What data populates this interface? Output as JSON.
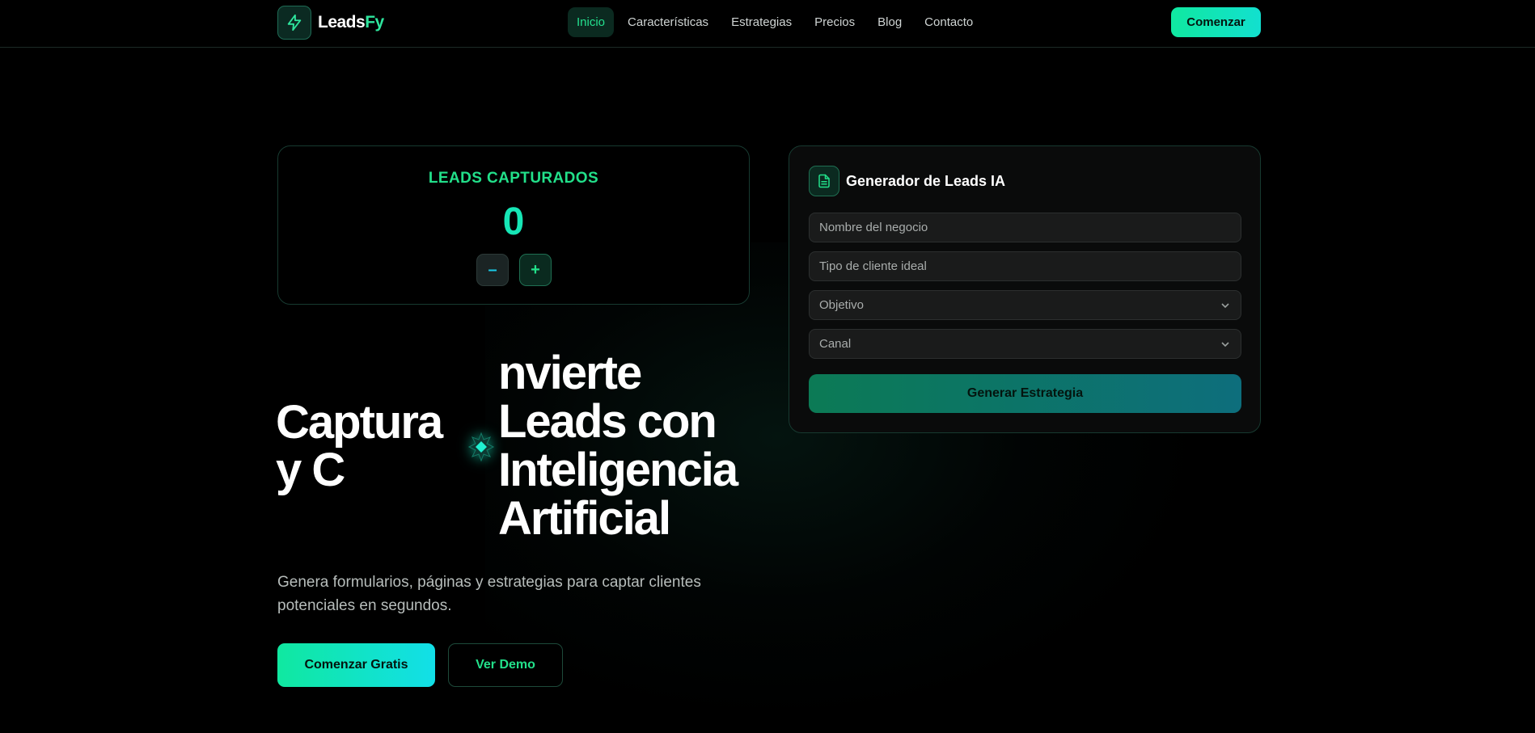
{
  "brand": {
    "name_part1": "Leads",
    "name_part2": "Fy",
    "icon": "lightning-icon"
  },
  "nav": {
    "items": [
      {
        "label": "Inicio",
        "active": true
      },
      {
        "label": "Características",
        "active": false
      },
      {
        "label": "Estrategias",
        "active": false
      },
      {
        "label": "Precios",
        "active": false
      },
      {
        "label": "Blog",
        "active": false
      },
      {
        "label": "Contacto",
        "active": false
      }
    ],
    "cta_label": "Comenzar"
  },
  "counter": {
    "title": "LEADS CAPTURADOS",
    "value": "0",
    "minus_label": "–",
    "plus_label": "+"
  },
  "hero": {
    "left_lines": [
      "Captura",
      "y C"
    ],
    "right_lines": [
      "nvierte",
      "Leads con",
      "Inteligencia",
      "Artificial"
    ],
    "subtitle": "Genera formularios, páginas y estrategias para captar clientes potenciales en segundos.",
    "primary_label": "Comenzar Gratis",
    "secondary_label": "Ver Demo"
  },
  "generator": {
    "icon": "document-icon",
    "title": "Generador de Leads IA",
    "business_placeholder": "Nombre del negocio",
    "client_placeholder": "Tipo de cliente ideal",
    "objective_label": "Objetivo",
    "channel_label": "Canal",
    "submit_label": "Generar Estrategia"
  },
  "colors": {
    "accent_green": "#22e08a",
    "accent_cyan": "#12e0cf",
    "background": "#000000",
    "card_border": "#173a30"
  }
}
